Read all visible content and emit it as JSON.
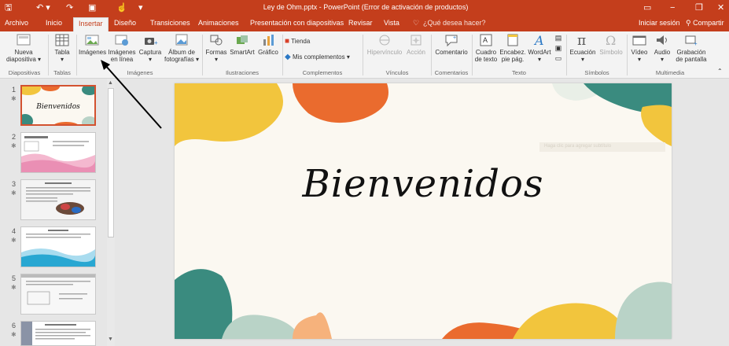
{
  "titlebar": {
    "title": "Ley de Ohm.pptx - PowerPoint (Error de activación de productos)",
    "save_icon": "save-icon",
    "undo_icon": "undo-icon",
    "redo_icon": "redo-icon",
    "background": "#c43e1c"
  },
  "tabs": {
    "archivo": "Archivo",
    "inicio": "Inicio",
    "insertar": "Insertar",
    "diseno": "Diseño",
    "transiciones": "Transiciones",
    "animaciones": "Animaciones",
    "presentacion": "Presentación con diapositivas",
    "revisar": "Revisar",
    "vista": "Vista",
    "tell_me": "¿Qué desea hacer?",
    "signin": "Iniciar sesión",
    "share": "Compartir"
  },
  "ribbon": {
    "nueva_1": "Nueva",
    "nueva_2": "diapositiva ▾",
    "tabla_1": "Tabla",
    "tabla_2": "▾",
    "imagenes": "Imágenes",
    "img_linea_1": "Imágenes",
    "img_linea_2": "en línea",
    "captura_1": "Captura",
    "captura_2": "▾",
    "album_1": "Álbum de",
    "album_2": "fotografías ▾",
    "formas_1": "Formas",
    "formas_2": "▾",
    "smartart": "SmartArt",
    "grafico": "Gráfico",
    "tienda": "Tienda",
    "mis_complementos": "Mis complementos ▾",
    "hipervinculo": "Hipervínculo",
    "accion": "Acción",
    "comentario": "Comentario",
    "cuadro_1": "Cuadro",
    "cuadro_2": "de texto",
    "encabez_1": "Encabez.",
    "encabez_2": "pie pág.",
    "wordart_1": "WordArt",
    "wordart_2": "▾",
    "ecuacion_1": "Ecuación",
    "ecuacion_2": "▾",
    "simbolo": "Símbolo",
    "video_1": "Vídeo",
    "video_2": "▾",
    "audio_1": "Audio",
    "audio_2": "▾",
    "grabacion_1": "Grabación",
    "grabacion_2": "de pantalla",
    "groups": {
      "diapositivas": "Diapositivas",
      "tablas": "Tablas",
      "imagenes": "Imágenes",
      "ilustraciones": "Ilustraciones",
      "complementos": "Complementos",
      "vinculos": "Vínculos",
      "comentarios": "Comentarios",
      "texto": "Texto",
      "simbolos": "Símbolos",
      "multimedia": "Multimedia"
    }
  },
  "slides": [
    {
      "number": "1"
    },
    {
      "number": "2"
    },
    {
      "number": "3"
    },
    {
      "number": "4"
    },
    {
      "number": "5"
    },
    {
      "number": "6"
    }
  ],
  "slide": {
    "title": "Bienvenidos",
    "subtitle_placeholder": "Haga clic para agregar subtítulo"
  },
  "colors": {
    "accent": "#c43e1c",
    "blob_yellow": "#f2c53d",
    "blob_orange": "#ea6b2e",
    "blob_teal": "#3a8b7f",
    "blob_mint": "#b9d3c7"
  }
}
